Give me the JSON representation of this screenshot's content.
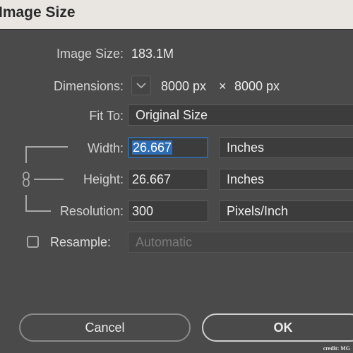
{
  "window": {
    "title": "Image Size"
  },
  "image_size": {
    "label": "Image Size:",
    "value": "183.1M"
  },
  "dimensions": {
    "label": "Dimensions:",
    "width": "8000 px",
    "times": "×",
    "height": "8000 px"
  },
  "fit_to": {
    "label": "Fit To:",
    "value": "Original Size"
  },
  "width": {
    "label": "Width:",
    "value": "26.667",
    "unit": "Inches"
  },
  "height": {
    "label": "Height:",
    "value": "26.667",
    "unit": "Inches"
  },
  "resolution": {
    "label": "Resolution:",
    "value": "300",
    "unit": "Pixels/Inch"
  },
  "resample": {
    "label": "Resample:",
    "value": "Automatic",
    "checked": false
  },
  "buttons": {
    "cancel": "Cancel",
    "ok": "OK"
  },
  "credit": "credit: MG",
  "icons": {
    "dimensions_toggle": "chevron-down-icon",
    "constrain": "chain-link-icon"
  },
  "colors": {
    "selection": "#2f6db3",
    "focus_border": "#3a6ea5",
    "background": "#4a4a4a"
  }
}
